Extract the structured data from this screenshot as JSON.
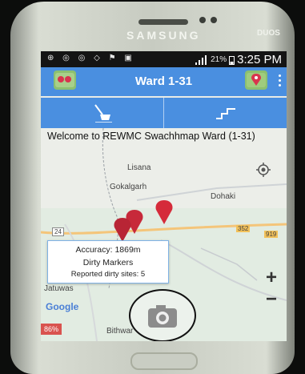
{
  "device": {
    "brand": "SAMSUNG",
    "model": "DUOS"
  },
  "statusbar": {
    "battery": "21%",
    "time": "3:25 PM"
  },
  "appbar": {
    "title": "Ward 1-31"
  },
  "map": {
    "welcome": "Welcome to REWMC Swachhmap Ward (1-31)",
    "places": [
      "Lisana",
      "Gokalgarh",
      "Dohaki",
      "Jatuwas",
      "Bithwar"
    ],
    "road_labels": [
      "24",
      "352",
      "919"
    ],
    "info": {
      "accuracy": "Accuracy: 1869m",
      "title": "Dirty Markers",
      "subtitle": "Reported dirty sites: 5"
    },
    "zoom_in": "+",
    "zoom_out": "−",
    "google": "Google",
    "badge": "86%"
  },
  "colors": {
    "accent": "#4a8fe0",
    "marker": "#d52b3a"
  }
}
